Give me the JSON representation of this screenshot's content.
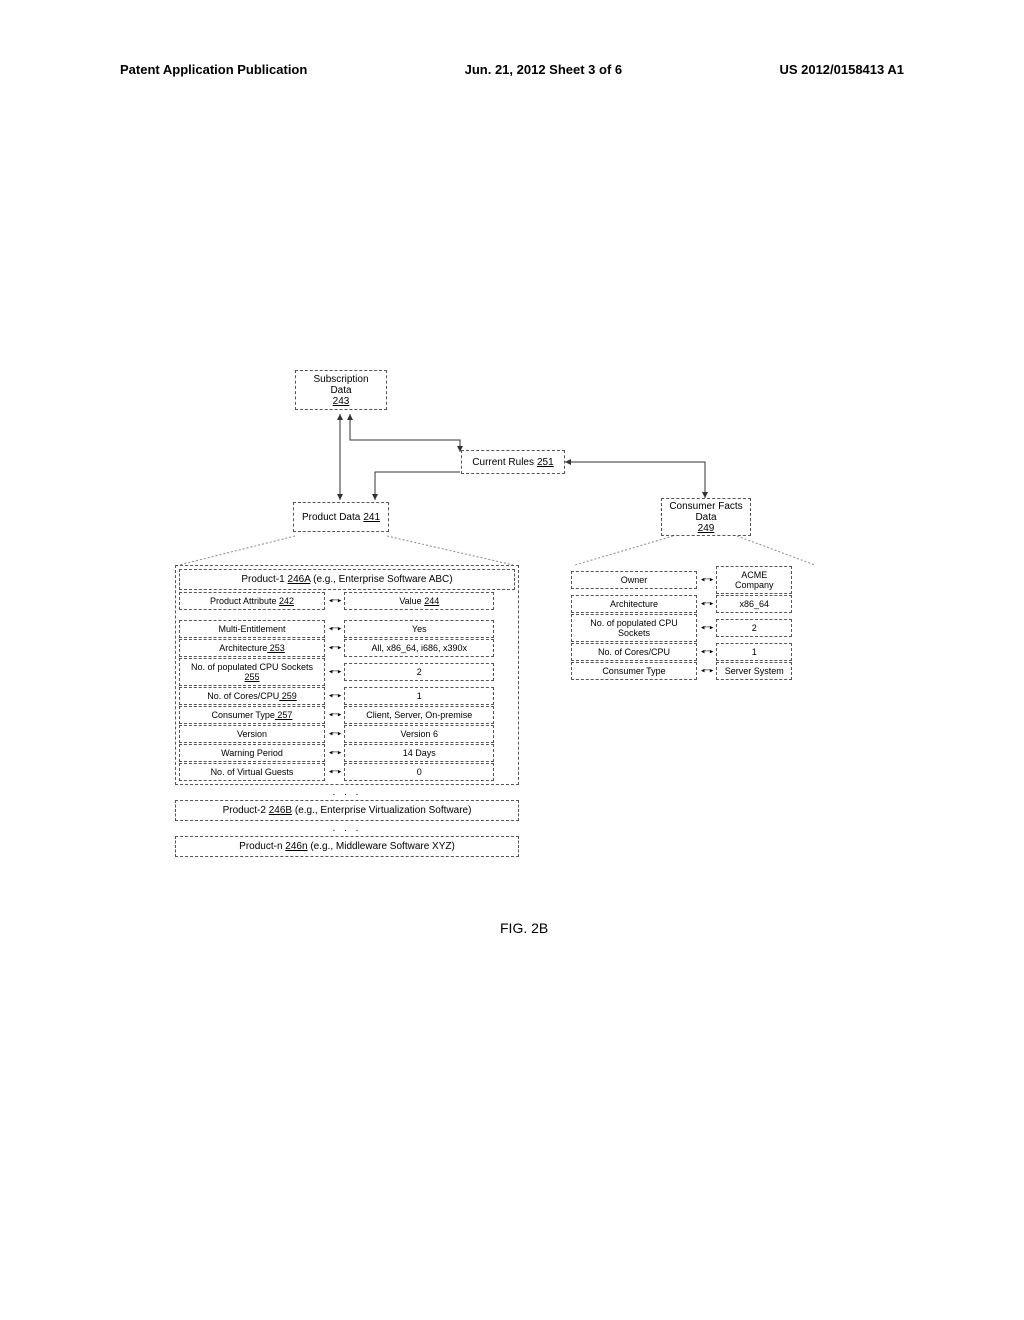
{
  "header": {
    "left": "Patent Application Publication",
    "center": "Jun. 21, 2012  Sheet 3 of 6",
    "right": "US 2012/0158413 A1"
  },
  "figure_label": "FIG. 2B",
  "boxes": {
    "subscription": {
      "label": "Subscription Data",
      "ref": "243"
    },
    "current_rules": {
      "label": "Current Rules",
      "ref": "251"
    },
    "product_data": {
      "label": "Product Data",
      "ref": "241"
    },
    "consumer_facts": {
      "label": "Consumer Facts Data",
      "ref": "249"
    }
  },
  "product_detail": {
    "header_prefix": "Product-1",
    "header_ref": "246A",
    "header_suffix": " (e.g., Enterprise Software ABC)",
    "col_left": {
      "label": "Product Attribute",
      "ref": "242"
    },
    "col_right": {
      "label": "Value",
      "ref": "244"
    },
    "rows": [
      {
        "attr": "Multi-Entitlement",
        "attr_ref": "",
        "val": "Yes"
      },
      {
        "attr": "Architecture",
        "attr_ref": "253",
        "val": "All, x86_64, i686, x390x"
      },
      {
        "attr": "No. of populated CPU Sockets",
        "attr_ref": "255",
        "val": "2"
      },
      {
        "attr": "No. of Cores/CPU",
        "attr_ref": "259",
        "val": "1"
      },
      {
        "attr": "Consumer Type",
        "attr_ref": "257",
        "val": "Client, Server, On-premise"
      },
      {
        "attr": "Version",
        "attr_ref": "",
        "val": "Version 6"
      },
      {
        "attr": "Warning Period",
        "attr_ref": "",
        "val": "14 Days"
      },
      {
        "attr": "No. of Virtual Guests",
        "attr_ref": "",
        "val": "0"
      }
    ],
    "product2_prefix": "Product-2",
    "product2_ref": "246B",
    "product2_suffix": " (e.g., Enterprise Virtualization Software)",
    "productn_prefix": "Product-n",
    "productn_ref": "246n",
    "productn_suffix": " (e.g., Middleware Software XYZ)"
  },
  "consumer_facts_detail": {
    "rows": [
      {
        "attr": "Owner",
        "val": "ACME Company"
      },
      {
        "attr": "Architecture",
        "val": "x86_64"
      },
      {
        "attr": "No. of populated CPU Sockets",
        "val": "2"
      },
      {
        "attr": "No. of Cores/CPU",
        "val": "1"
      },
      {
        "attr": "Consumer Type",
        "val": "Server System"
      }
    ]
  },
  "chart_data": {
    "type": "table",
    "title": "FIG. 2B — Subscription / Product Data model",
    "nodes": [
      {
        "id": "243",
        "label": "Subscription Data"
      },
      {
        "id": "251",
        "label": "Current Rules"
      },
      {
        "id": "241",
        "label": "Product Data"
      },
      {
        "id": "249",
        "label": "Consumer Facts Data"
      }
    ],
    "edges": [
      {
        "from": "243",
        "to": "251",
        "style": "bidirectional"
      },
      {
        "from": "243",
        "to": "241",
        "style": "bidirectional"
      },
      {
        "from": "251",
        "to": "241",
        "style": "arrow"
      },
      {
        "from": "251",
        "to": "249",
        "style": "arrow"
      }
    ],
    "product_attributes": [
      {
        "name": "Multi-Entitlement",
        "value": "Yes"
      },
      {
        "name": "Architecture",
        "value": "All, x86_64, i686, x390x"
      },
      {
        "name": "No. of populated CPU Sockets",
        "value": "2"
      },
      {
        "name": "No. of Cores/CPU",
        "value": "1"
      },
      {
        "name": "Consumer Type",
        "value": "Client, Server, On-premise"
      },
      {
        "name": "Version",
        "value": "Version 6"
      },
      {
        "name": "Warning Period",
        "value": "14 Days"
      },
      {
        "name": "No. of Virtual Guests",
        "value": "0"
      }
    ],
    "consumer_facts": [
      {
        "name": "Owner",
        "value": "ACME Company"
      },
      {
        "name": "Architecture",
        "value": "x86_64"
      },
      {
        "name": "No. of populated CPU Sockets",
        "value": "2"
      },
      {
        "name": "No. of Cores/CPU",
        "value": "1"
      },
      {
        "name": "Consumer Type",
        "value": "Server System"
      }
    ]
  }
}
